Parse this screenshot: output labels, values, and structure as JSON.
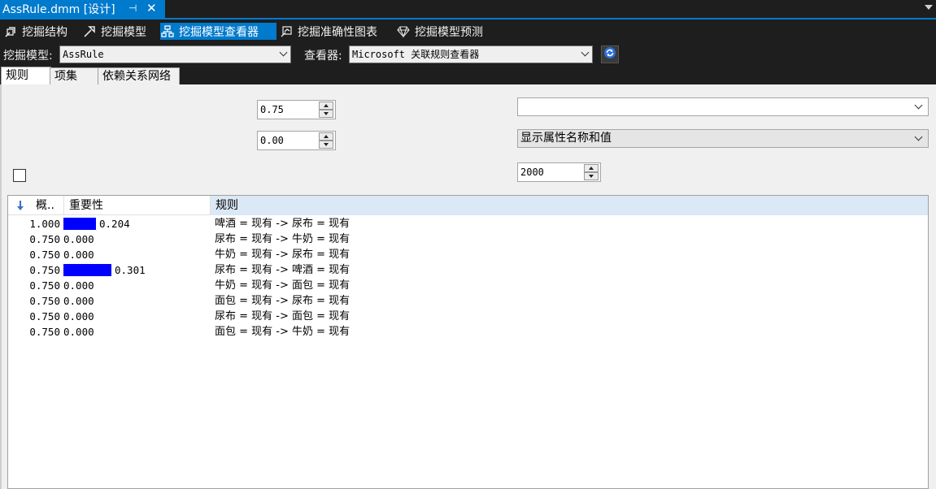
{
  "doc_tab": {
    "title": "AssRule.dmm [设计]",
    "pin": "⊣",
    "close": "✕"
  },
  "designer_tabs": [
    {
      "label": "挖掘结构",
      "icon": "mining-structure-icon"
    },
    {
      "label": "挖掘模型",
      "icon": "mining-model-icon"
    },
    {
      "label": "挖掘模型查看器",
      "icon": "mining-viewer-icon"
    },
    {
      "label": "挖掘准确性图表",
      "icon": "accuracy-chart-icon"
    },
    {
      "label": "挖掘模型预测",
      "icon": "prediction-icon"
    }
  ],
  "selectors": {
    "model_label": "挖掘模型:",
    "model_value": "AssRule",
    "viewer_label": "查看器:",
    "viewer_value": "Microsoft 关联规则查看器"
  },
  "viewer_tabs": [
    "规则",
    "项集",
    "依赖关系网络"
  ],
  "controls": {
    "min_probability": "0.75",
    "min_importance": "0.00",
    "filter_value": "",
    "display_value": "显示属性名称和值",
    "max_rows": "2000"
  },
  "grid": {
    "headers": {
      "probability": "概..",
      "importance": "重要性",
      "rule": "规则"
    },
    "rows": [
      {
        "prob": "1.000",
        "importance": "0.204",
        "bar": 0.204,
        "rule": "啤酒 = 现有 -> 尿布 = 现有"
      },
      {
        "prob": "0.750",
        "importance": "0.000",
        "bar": 0,
        "rule": "尿布 = 现有 -> 牛奶 = 现有"
      },
      {
        "prob": "0.750",
        "importance": "0.000",
        "bar": 0,
        "rule": "牛奶 = 现有 -> 尿布 = 现有"
      },
      {
        "prob": "0.750",
        "importance": "0.301",
        "bar": 0.301,
        "rule": "尿布 = 现有 -> 啤酒 = 现有"
      },
      {
        "prob": "0.750",
        "importance": "0.000",
        "bar": 0,
        "rule": "牛奶 = 现有 -> 面包 = 现有"
      },
      {
        "prob": "0.750",
        "importance": "0.000",
        "bar": 0,
        "rule": "面包 = 现有 -> 尿布 = 现有"
      },
      {
        "prob": "0.750",
        "importance": "0.000",
        "bar": 0,
        "rule": "尿布 = 现有 -> 面包 = 现有"
      },
      {
        "prob": "0.750",
        "importance": "0.000",
        "bar": 0,
        "rule": "面包 = 现有 -> 牛奶 = 现有"
      }
    ]
  },
  "colors": {
    "accent": "#007acc",
    "importance_bar": "#0000ff",
    "header_highlight": "#dbe8f5"
  }
}
